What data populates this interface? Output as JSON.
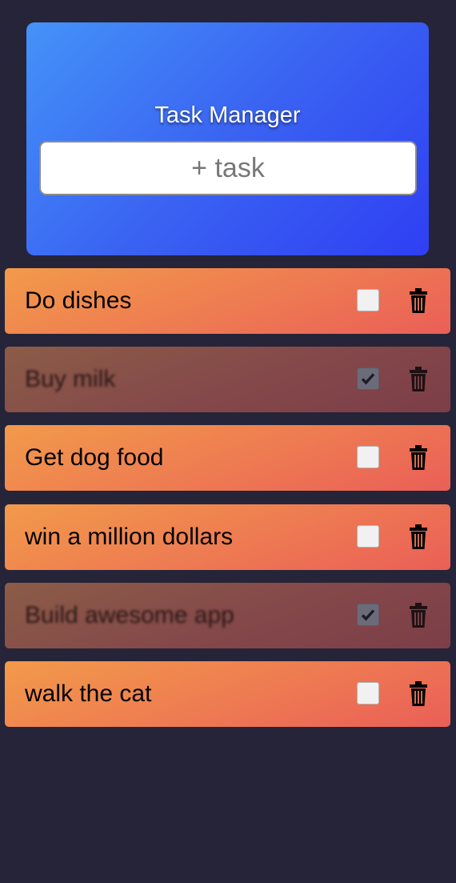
{
  "header": {
    "title": "Task Manager",
    "input_placeholder": "+ task"
  },
  "tasks": [
    {
      "label": "Do dishes",
      "done": false
    },
    {
      "label": "Buy milk",
      "done": true
    },
    {
      "label": "Get dog food",
      "done": false
    },
    {
      "label": "win a million dollars",
      "done": false
    },
    {
      "label": "Build awesome app",
      "done": true
    },
    {
      "label": "walk the cat",
      "done": false
    }
  ],
  "icons": {
    "delete": "trash-icon",
    "check": "checkmark-icon"
  },
  "colors": {
    "background": "#262438",
    "header_gradient_start": "#4493f8",
    "header_gradient_end": "#2f3ff3",
    "task_gradient_start": "#f29a4a",
    "task_gradient_end": "#ea5f57",
    "task_done_start": "#8c5c47",
    "task_done_end": "#7d3e48"
  }
}
